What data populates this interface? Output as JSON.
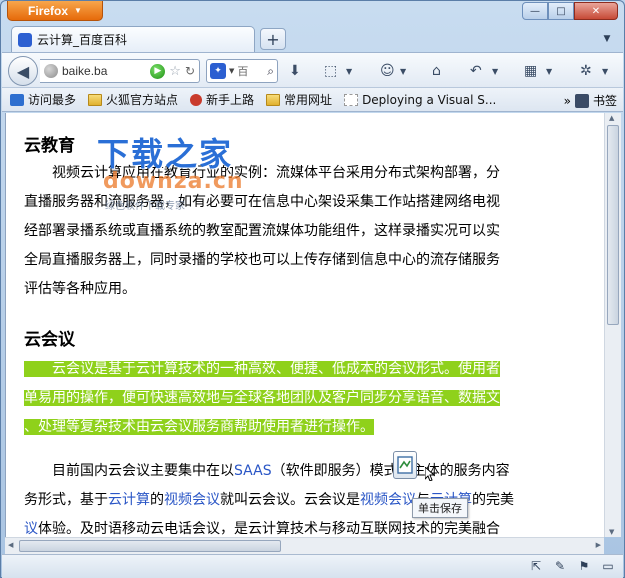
{
  "browser": {
    "menu_label": "Firefox",
    "tab_title": "云计算_百度百科",
    "new_tab_label": "+",
    "url": "baike.ba",
    "search_engine_text": "百",
    "window_controls": {
      "minimize": "—",
      "maximize": "□",
      "close": "✕"
    }
  },
  "bookmarks": {
    "items": [
      "访问最多",
      "火狐官方站点",
      "新手上路",
      "常用网址",
      "Deploying a Visual S..."
    ],
    "overflow_label": "»",
    "bookmarks_menu": "书签"
  },
  "article": {
    "section1_title": "云教育",
    "section1_lines": [
      "　　视频云计算应用在教育行业的实例：流媒体平台采用分布式架构部署，分",
      "直播服务器和流服务器，如有必要可在信息中心架设采集工作站搭建网络电视",
      "经部署录播系统或直播系统的教室配置流媒体功能组件，这样录播实况可以实",
      "全局直播服务器上，同时录播的学校也可以上传存储到信息中心的流存储服务",
      "评估等各种应用。"
    ],
    "section2_title": "云会议",
    "section2_highlight_lines": [
      "　　云会议是基于云计算技术的一种高效、便捷、低成本的会议形式。使用者",
      "单易用的操作，便可快速高效地与全球各地团队及客户同步分享语音、数据文",
      "、处理等复杂技术由云会议服务商帮助使用者进行操作。"
    ],
    "para3_line1_a": "　　目前国内云会议主要集中在以",
    "para3_line1_link": "SAAS",
    "para3_line1_b": "（软件即服务）模式为主体的服务内容",
    "para3_line2_a": "务形式，基于",
    "para3_line2_link1": "云计算",
    "para3_line2_b": "的",
    "para3_line2_link2": "视频会议",
    "para3_line2_c": "就叫云会议。云会议是",
    "para3_line2_link3": "视频会议",
    "para3_line2_d": "与",
    "para3_line2_link4": "云计算",
    "para3_line2_e": "的完美",
    "para3_line3_link": "议",
    "para3_line3_a": "体验。及时语移动云电话会议，是云计算技术与移动互联网技术的完美融合"
  },
  "watermark": {
    "title": "下载之家",
    "url": "downza.cn",
    "slogan": "绿色软件下载专家"
  },
  "tooltip": {
    "save_text": "单击保存"
  },
  "icons": [
    "back-icon",
    "globe-icon",
    "go-icon",
    "star-icon",
    "reload-icon",
    "search-icon",
    "download-icon",
    "screenshot-icon",
    "addon-icon",
    "home-icon",
    "history-icon",
    "apps-icon",
    "firefox-icon",
    "bookmark-star-icon",
    "save-icon"
  ]
}
